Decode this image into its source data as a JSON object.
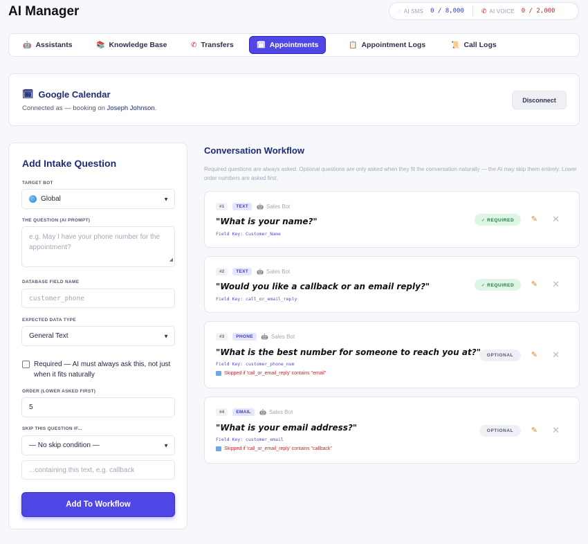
{
  "app": {
    "title": "AI Manager"
  },
  "quota": {
    "sms_label": "AI SMS",
    "sms_value": "0 / 8,000",
    "voice_label": "AI VOICE",
    "voice_value": "0 / 2,000"
  },
  "tabs": [
    {
      "label": "Assistants",
      "icon": "robot-icon",
      "active": false
    },
    {
      "label": "Knowledge Base",
      "icon": "books-icon",
      "active": false
    },
    {
      "label": "Transfers",
      "icon": "phone-icon",
      "active": false
    },
    {
      "label": "Appointments",
      "icon": "calendar-icon",
      "active": true
    },
    {
      "label": "Appointment Logs",
      "icon": "clipboard-icon",
      "active": false
    },
    {
      "label": "Call Logs",
      "icon": "scroll-icon",
      "active": false
    }
  ],
  "calendar": {
    "title": "Google Calendar",
    "connected_prefix": "Connected as — booking on",
    "user": "Joseph Johnson",
    "user_suffix": ".",
    "disconnect_label": "Disconnect"
  },
  "form": {
    "title": "Add Intake Question",
    "target_bot_label": "TARGET BOT",
    "target_bot_value": "Global",
    "question_label": "THE QUESTION (AI PROMPT)",
    "question_placeholder": "e.g. May I have your phone number for the appointment?",
    "field_name_label": "DATABASE FIELD NAME",
    "field_name_placeholder": "customer_phone",
    "data_type_label": "EXPECTED DATA TYPE",
    "data_type_value": "General Text",
    "required_label": "Required — AI must always ask this, not just when it fits naturally",
    "order_label": "ORDER (LOWER ASKED FIRST)",
    "order_value": "5",
    "skip_label": "SKIP THIS QUESTION IF...",
    "skip_value": "— No skip condition —",
    "skip_text_placeholder": "...containing this text, e.g. callback",
    "submit_label": "Add To Workflow"
  },
  "workflow": {
    "title": "Conversation Workflow",
    "description": "Required questions are always asked. Optional questions are only asked when they fit the conversation naturally — the AI may skip them entirely. Lower order numbers are asked first.",
    "questions": [
      {
        "num": "#1",
        "type": "TEXT",
        "bot": "Sales Bot",
        "text": "\"What is your name?\"",
        "key": "Field Key: Customer_Name",
        "skip": "",
        "status": "✓ REQUIRED"
      },
      {
        "num": "#2",
        "type": "TEXT",
        "bot": "Sales Bot",
        "text": "\"Would you like a callback or an email reply?\"",
        "key": "Field Key: call_or_email_reply",
        "skip": "",
        "status": "✓ REQUIRED"
      },
      {
        "num": "#3",
        "type": "PHONE",
        "bot": "Sales Bot",
        "text": "\"What is the best number for someone to reach you at?\"",
        "key": "Field Key: customer_phone_num",
        "skip": "Skipped if 'call_or_email_reply' contains \"email\"",
        "status": "OPTIONAL"
      },
      {
        "num": "#4",
        "type": "EMAIL",
        "bot": "Sales Bot",
        "text": "\"What is your email address?\"",
        "key": "Field Key: customer_email",
        "skip": "Skipped if 'call_or_email_reply' contains \"callback\"",
        "status": "OPTIONAL"
      }
    ]
  },
  "colors": {
    "accent": "#4f46e5",
    "title": "#1e2a78",
    "danger": "#c0262c",
    "success_bg": "#dff5e6"
  }
}
